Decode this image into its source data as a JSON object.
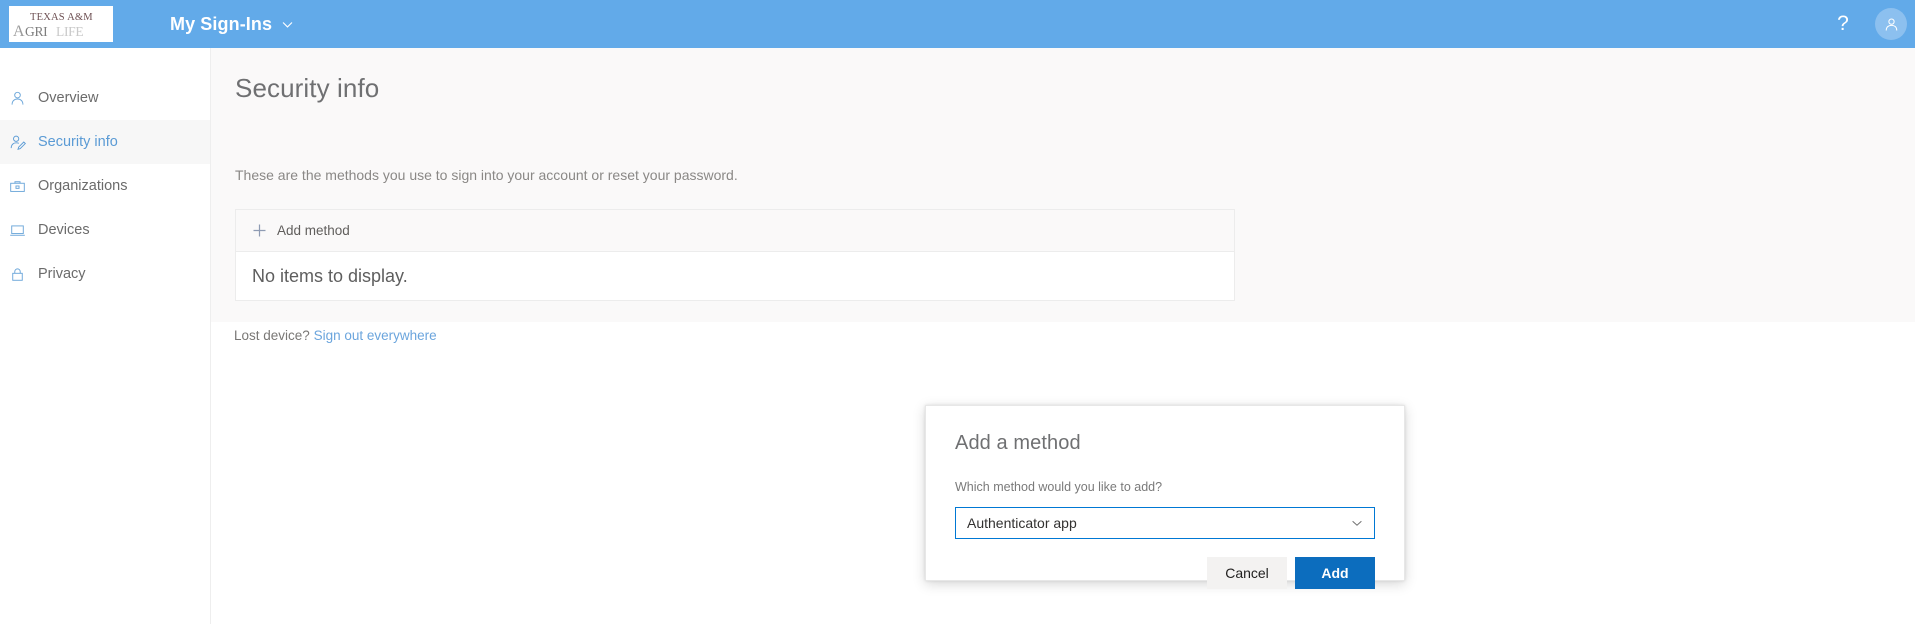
{
  "topbar": {
    "logo_name": "texas-am-agrilife-logo",
    "logo_line1": "TEXAS A&M",
    "logo_line2": "AGRILIFE",
    "title": "My Sign-Ins",
    "chevron_icon": "chevron-down-icon",
    "help_icon": "question-mark-icon",
    "help_label": "?",
    "avatar_icon": "user-avatar-icon",
    "background_color": "#62aae9"
  },
  "sidebar": {
    "items": [
      {
        "label": "Overview",
        "icon": "person-icon",
        "active": false
      },
      {
        "label": "Security info",
        "icon": "person-edit-icon",
        "active": true
      },
      {
        "label": "Organizations",
        "icon": "briefcase-icon",
        "active": false
      },
      {
        "label": "Devices",
        "icon": "laptop-icon",
        "active": false
      },
      {
        "label": "Privacy",
        "icon": "lock-icon",
        "active": false
      }
    ],
    "active_color": "#5b9bd5"
  },
  "main": {
    "page_title": "Security info",
    "page_subtitle": "These are the methods you use to sign into your account or reset your password.",
    "panel": {
      "add_method_label": "Add method",
      "add_method_icon": "plus-icon",
      "empty_message": "No items to display."
    },
    "lost_device": {
      "prompt": "Lost device?",
      "link_label": "Sign out everywhere"
    }
  },
  "dialog": {
    "title": "Add a method",
    "question": "Which method would you like to add?",
    "dropdown": {
      "selected": "Authenticator app",
      "chevron_icon": "chevron-down-icon",
      "options": [
        "Authenticator app"
      ]
    },
    "cancel_label": "Cancel",
    "add_label": "Add",
    "primary_color": "#0c6dbe",
    "focus_border_color": "#0078d4"
  }
}
